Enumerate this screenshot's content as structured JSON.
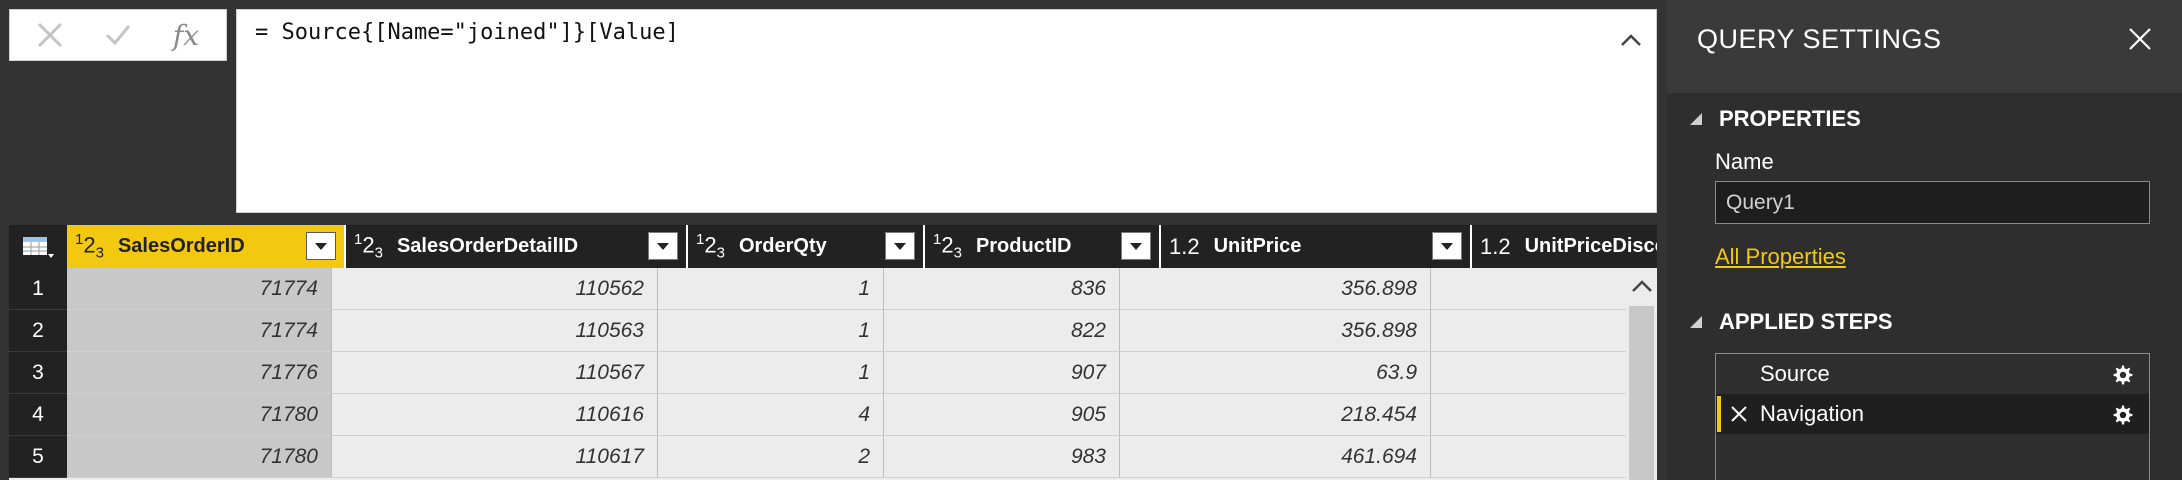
{
  "formula_bar": {
    "cancel_icon": "close-x-icon",
    "commit_icon": "checkmark-icon",
    "fx_label": "fx",
    "formula": "= Source{[Name=\"joined\"]}[Value]",
    "collapse_icon": "chevron-up-icon"
  },
  "grid": {
    "columns": [
      {
        "type_sup": "1",
        "type_mid": "2",
        "type_sub": "3",
        "type_plain": "",
        "name": "SalesOrderID",
        "selected": true
      },
      {
        "type_sup": "1",
        "type_mid": "2",
        "type_sub": "3",
        "type_plain": "",
        "name": "SalesOrderDetailID",
        "selected": false
      },
      {
        "type_sup": "1",
        "type_mid": "2",
        "type_sub": "3",
        "type_plain": "",
        "name": "OrderQty",
        "selected": false
      },
      {
        "type_sup": "1",
        "type_mid": "2",
        "type_sub": "3",
        "type_plain": "",
        "name": "ProductID",
        "selected": false
      },
      {
        "type_sup": "",
        "type_mid": "",
        "type_sub": "",
        "type_plain": "1.2",
        "name": "UnitPrice",
        "selected": false
      },
      {
        "type_sup": "",
        "type_mid": "",
        "type_sub": "",
        "type_plain": "1.2",
        "name": "UnitPriceDiscount",
        "selected": false
      }
    ],
    "rows": [
      {
        "n": "1",
        "cells": [
          "71774",
          "110562",
          "1",
          "836",
          "356.898",
          ""
        ]
      },
      {
        "n": "2",
        "cells": [
          "71774",
          "110563",
          "1",
          "822",
          "356.898",
          ""
        ]
      },
      {
        "n": "3",
        "cells": [
          "71776",
          "110567",
          "1",
          "907",
          "63.9",
          ""
        ]
      },
      {
        "n": "4",
        "cells": [
          "71780",
          "110616",
          "4",
          "905",
          "218.454",
          ""
        ]
      },
      {
        "n": "5",
        "cells": [
          "71780",
          "110617",
          "2",
          "983",
          "461.694",
          ""
        ]
      }
    ]
  },
  "query_settings": {
    "title": "QUERY SETTINGS",
    "close_icon": "close-icon",
    "properties_header": "PROPERTIES",
    "name_label": "Name",
    "name_value": "Query1",
    "all_properties_link": "All Properties",
    "applied_steps_header": "APPLIED STEPS",
    "steps": [
      {
        "label": "Source",
        "active": false
      },
      {
        "label": "Navigation",
        "active": true
      }
    ]
  },
  "colors": {
    "accent": "#f2c811",
    "pane_bg": "#2e2e2e",
    "header_bg": "#222222"
  }
}
